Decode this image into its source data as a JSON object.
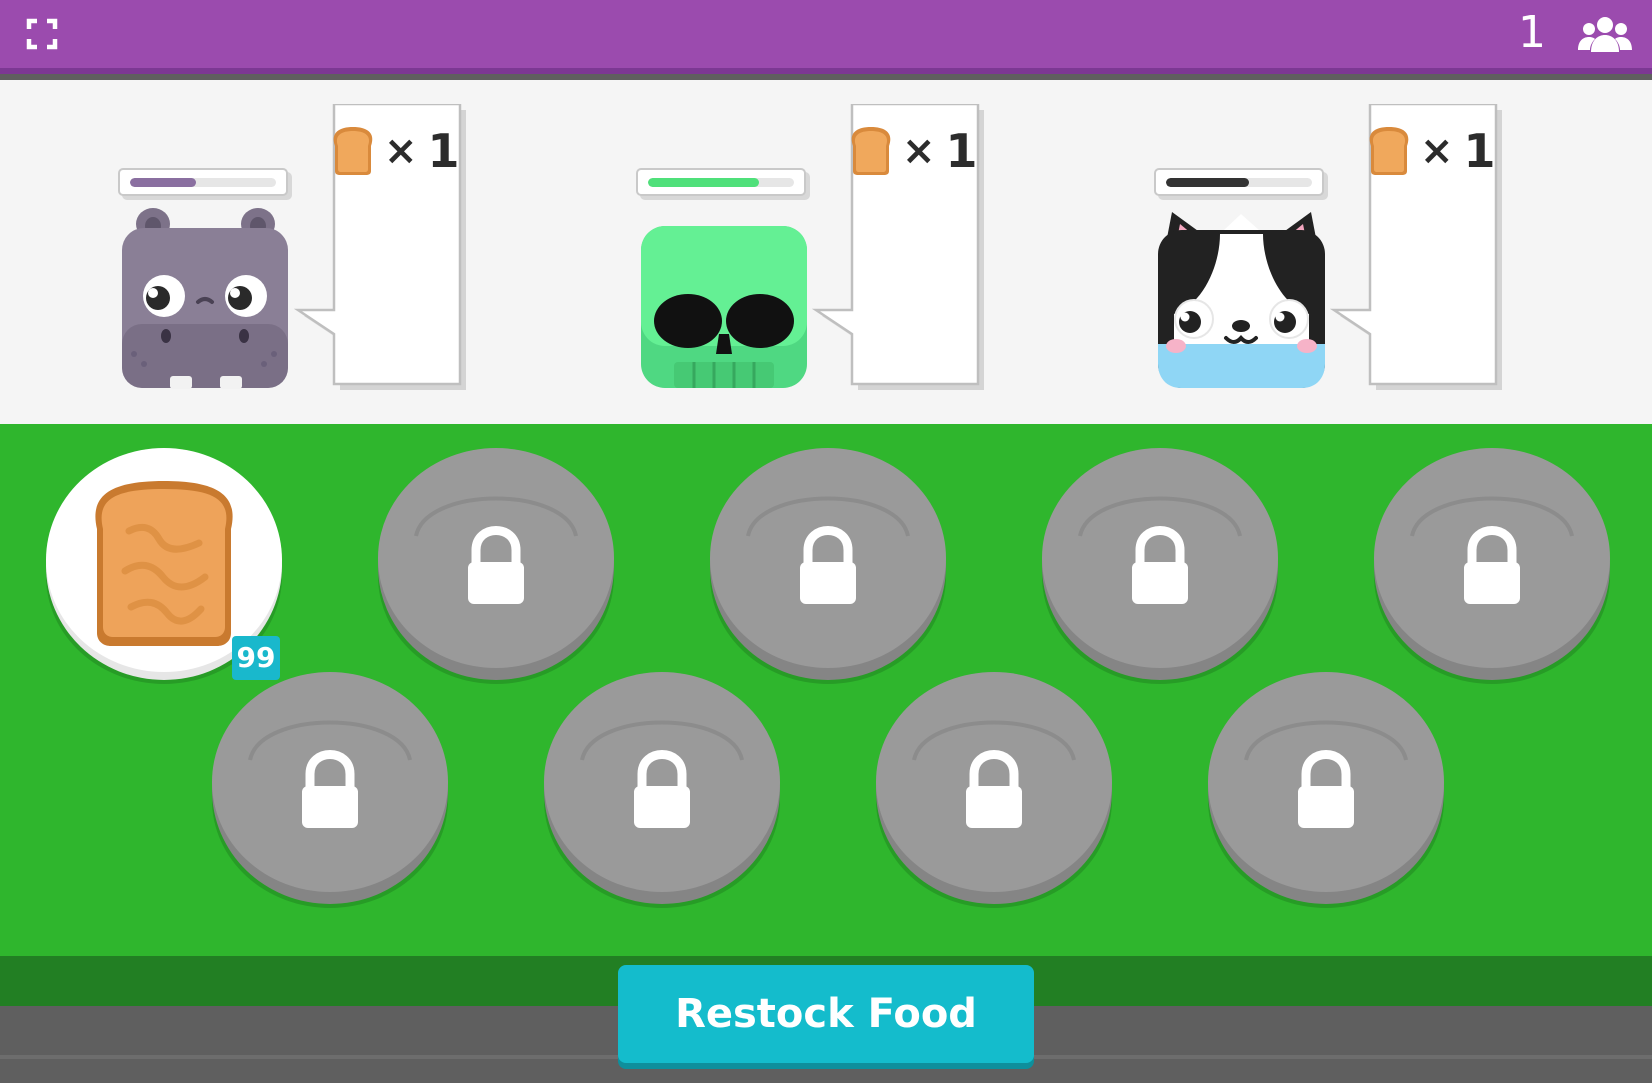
{
  "topbar": {
    "fullscreen_icon": "fullscreen-icon",
    "player_count": "1",
    "players_icon": "users-icon",
    "bar_color": "#9b4bae"
  },
  "customers": [
    {
      "name": "hippo",
      "patience": 0.45,
      "patience_color": "#8a6fa0",
      "order_item": "toast",
      "order_qty": "1"
    },
    {
      "name": "skull",
      "patience": 0.76,
      "patience_color": "#4fe07a",
      "order_item": "toast",
      "order_qty": "1"
    },
    {
      "name": "husky",
      "patience": 0.57,
      "patience_color": "#333333",
      "order_item": "toast",
      "order_qty": "1"
    }
  ],
  "order_times_symbol": "×",
  "plates": {
    "first": {
      "item": "toast",
      "stock": "99"
    },
    "locked_count": 8,
    "lock_icon": "lock-icon"
  },
  "restock_button": "Restock Food",
  "colors": {
    "counter": "#2fb62d",
    "restock": "#14bccc",
    "plate": "#9a9a9a"
  }
}
